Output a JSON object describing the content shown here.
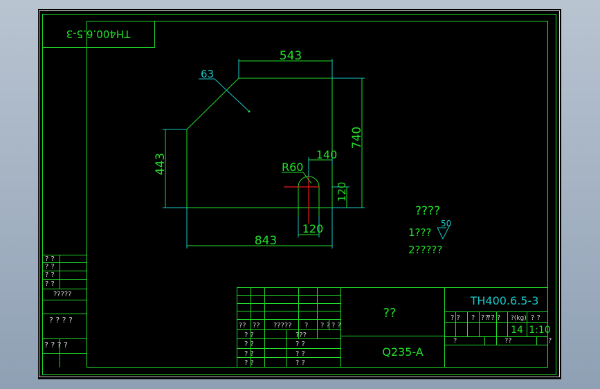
{
  "drawing": {
    "stamp_mirrored": "TH400.6.5-3",
    "note_heading": "????",
    "note_line1": "1???",
    "roughness_value": "50",
    "note_line2": "2?????"
  },
  "dimensions": {
    "top_width": "543",
    "height_right": "740",
    "left_height": "443",
    "bottom_width": "843",
    "slot_offset": "140",
    "radius": "R60",
    "slot_height": "120",
    "slot_width": "120",
    "chamfer": "63"
  },
  "side_table": {
    "row1": "? ?",
    "row2": "? ?",
    "row3": "? ?",
    "row4": "? ?",
    "row5": "?????",
    "row6": "? ? ? ?",
    "row7": "? ? ?   ?"
  },
  "title_block": {
    "drawing_number": "TH400.6.5-3",
    "part_name": "??",
    "material": "Q235-A",
    "header_cells": [
      "??",
      "??",
      "?????",
      "?",
      "? ?",
      "? ?"
    ],
    "sign_rows": [
      [
        "? ?",
        "???"
      ],
      [
        "? ?",
        "? ?"
      ],
      [
        "? ?",
        "? ?"
      ],
      [
        "? ?",
        "? ?"
      ]
    ],
    "info_header": [
      "? ?",
      "?",
      "? ?",
      "? ? ?",
      "?(kg)",
      "? ?"
    ],
    "weight": "14",
    "scale": "1:10",
    "sheet_left": "?",
    "sheet_mid": "??",
    "sheet_right": "?"
  }
}
